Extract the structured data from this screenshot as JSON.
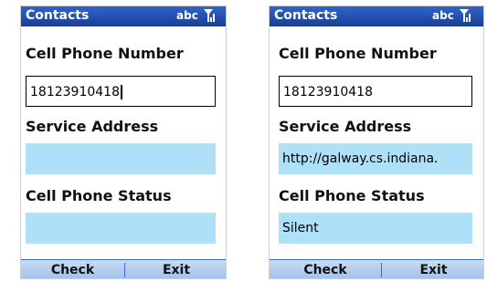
{
  "screens": [
    {
      "title": "Contacts",
      "input_indicator": "abc",
      "fields": [
        {
          "label": "Cell Phone Number",
          "value": "18123910418"
        },
        {
          "label": "Service Address",
          "value": ""
        },
        {
          "label": "Cell Phone Status",
          "value": ""
        }
      ],
      "softkeys": {
        "left": "Check",
        "right": "Exit"
      }
    },
    {
      "title": "Contacts",
      "input_indicator": "abc",
      "fields": [
        {
          "label": "Cell Phone Number",
          "value": "18123910418"
        },
        {
          "label": "Service Address",
          "value": "http://galway.cs.indiana."
        },
        {
          "label": "Cell Phone Status",
          "value": "Silent"
        }
      ],
      "softkeys": {
        "left": "Check",
        "right": "Exit"
      }
    }
  ],
  "colors": {
    "titlebar": "#1f4aa8",
    "readonly_field": "#aee0f7",
    "softbar": "#b4cdee"
  }
}
